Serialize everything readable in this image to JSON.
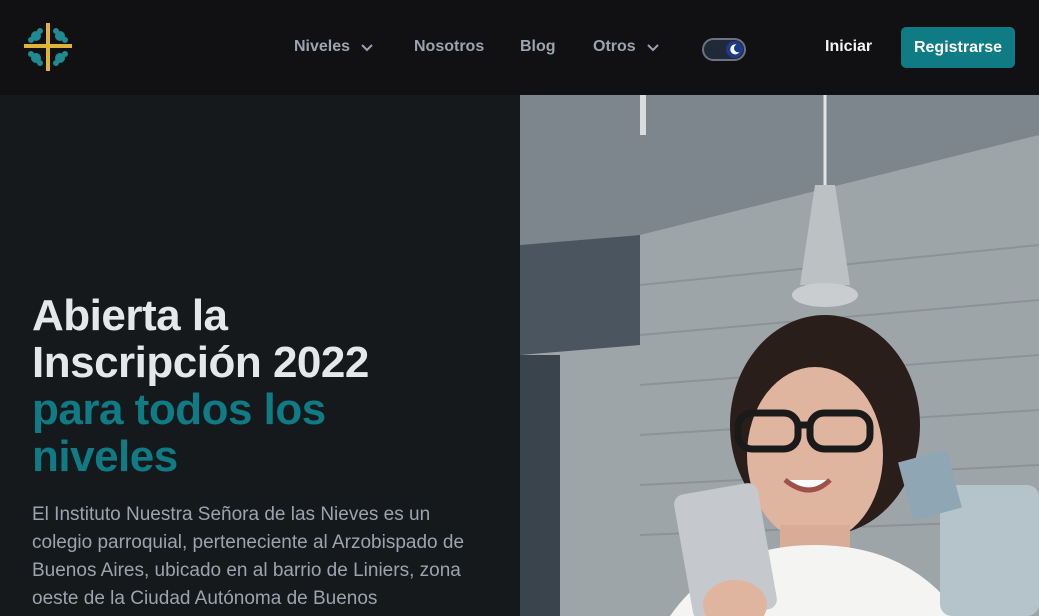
{
  "header": {
    "logo_icon": "cross-logo-icon",
    "nav": [
      {
        "label": "Niveles",
        "has_dropdown": true
      },
      {
        "label": "Nosotros",
        "has_dropdown": false
      },
      {
        "label": "Blog",
        "has_dropdown": false
      },
      {
        "label": "Otros",
        "has_dropdown": true
      }
    ],
    "theme_toggle_icon": "moon-icon",
    "login_label": "Iniciar",
    "register_label": "Registrarse"
  },
  "hero": {
    "headline_line1": "Abierta la",
    "headline_line2": "Inscripción 2022",
    "headline_accent1": "para todos los",
    "headline_accent2": "niveles",
    "description": "El Instituto Nuestra Señora de las Nieves es un colegio parroquial, perteneciente al Arzobispado de Buenos Aires, ubicado en al barrio de Liniers, zona oeste de la Ciudad Autónoma de Buenos",
    "photo": "woman-with-phone-photo"
  },
  "colors": {
    "accent": "#0f7c85",
    "header_bg": "#111114",
    "hero_bg": "#16191c",
    "logo_gold": "#e0b43a",
    "logo_teal": "#1f8a8f"
  }
}
